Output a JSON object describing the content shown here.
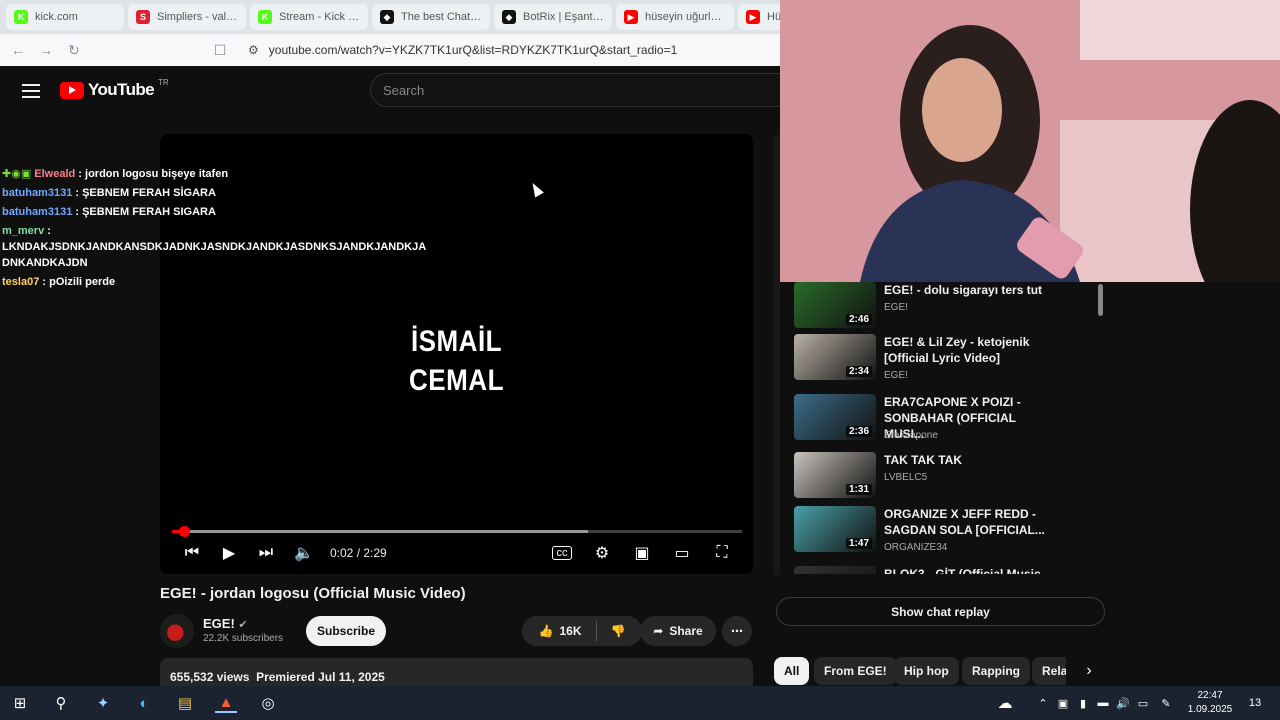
{
  "browser": {
    "tabs": [
      {
        "label": "kick.com",
        "color": "#53fc18",
        "glyph": "K"
      },
      {
        "label": "Simpliers - valorant",
        "color": "#e0202e",
        "glyph": "S"
      },
      {
        "label": "Stream - Kick Dash",
        "color": "#53fc18",
        "glyph": "K"
      },
      {
        "label": "The best ChatBot",
        "color": "#111111",
        "glyph": "◆"
      },
      {
        "label": "BotRix | Eşantiyon",
        "color": "#111111",
        "glyph": "◆"
      },
      {
        "label": "hüseyin uğurlu ba",
        "color": "#ff0000",
        "glyph": "▶"
      },
      {
        "label": "Hü",
        "color": "#ff0000",
        "glyph": "▶"
      }
    ],
    "url": "youtube.com/watch?v=YKZK7TK1urQ&list=RDYKZK7TK1urQ&start_radio=1"
  },
  "header": {
    "logo_text": "YouTube",
    "region": "TR",
    "search_placeholder": "Search"
  },
  "player": {
    "overlay_line1": "İSMAİL",
    "overlay_line2": "CEMAL",
    "time": "0:02 / 2:29",
    "progress": 0.013,
    "buffered": 0.73
  },
  "chat": [
    {
      "user": "Elweald",
      "user_color": "#ff7d8a",
      "text": ": jordon logosu bişeye itafen",
      "badges": true
    },
    {
      "user": "batuham3131",
      "user_color": "#6fa8ff",
      "text": ": ŞEBNEM FERAH SİGARA",
      "badges": false
    },
    {
      "user": "batuham3131",
      "user_color": "#6fa8ff",
      "text": ": ŞEBNEM FERAH SIGARA",
      "badges": false
    },
    {
      "user": "m_merv",
      "user_color": "#7fe0a0",
      "text": ": LKNDAKJSDNKJANDKANSDKJADNKJASNDKJANDKJASDNKSJANDKJANDKJA DNKANDKAJDN",
      "badges": false
    },
    {
      "user": "tesla07",
      "user_color": "#ffd166",
      "text": ": pOizili perde",
      "badges": false
    }
  ],
  "video": {
    "title": "EGE! - jordan logosu (Official Music Video)",
    "channel": "EGE!",
    "subscribers": "22.2K subscribers",
    "subscribe_label": "Subscribe",
    "likes": "16K",
    "share_label": "Share",
    "views": "655,532 views",
    "premiered": "Premiered Jul 11, 2025"
  },
  "playlist": [
    {
      "title": "EGE! - dolu sigarayı ters tut",
      "channel": "EGE!",
      "duration": "2:46",
      "thumb": "#2a6b2a"
    },
    {
      "title": "EGE! & Lil Zey - ketojenik [Official Lyric Video]",
      "channel": "EGE!",
      "duration": "2:34",
      "thumb": "#b9b2a6"
    },
    {
      "title": "ERA7CAPONE X POIZI - SONBAHAR (OFFICIAL MUSI...",
      "channel": "Era7capone",
      "duration": "2:36",
      "thumb": "#3c6d8a"
    },
    {
      "title": "TAK TAK TAK",
      "channel": "LVBELC5",
      "duration": "1:31",
      "thumb": "#c9c3bd"
    },
    {
      "title": "ORGANIZE X JEFF REDD - SAGDAN SOLA [OFFICIAL...",
      "channel": "ORGANIZE34",
      "duration": "1:47",
      "thumb": "#4aa0a8"
    },
    {
      "title": "BLOK3 - GİT (Official Music",
      "channel": "",
      "duration": "",
      "thumb": "#333333"
    }
  ],
  "show_chat_label": "Show chat replay",
  "chips": [
    "All",
    "From EGE!",
    "Hip hop",
    "Rapping",
    "Rela"
  ],
  "taskbar": {
    "time": "22:47",
    "date": "1.09.2025",
    "notif_count": "13"
  }
}
